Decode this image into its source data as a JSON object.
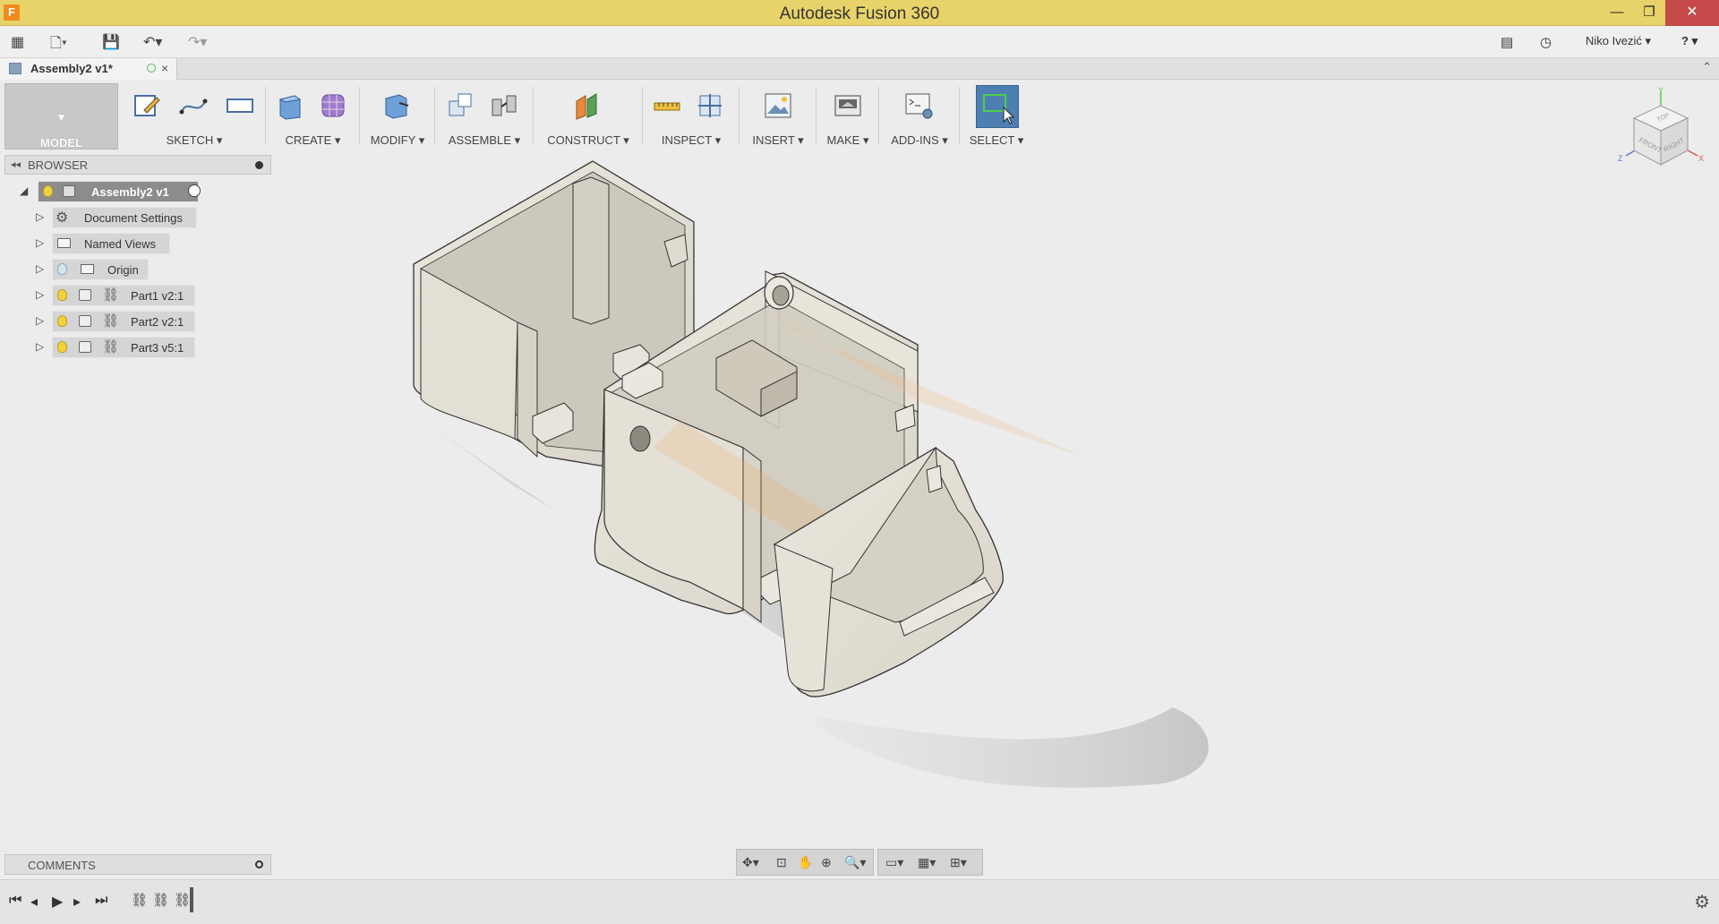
{
  "window": {
    "title": "Autodesk Fusion 360",
    "app_icon_letter": "F",
    "minimize": "—",
    "restore": "❐",
    "close": "✕"
  },
  "qat": {
    "user_name": "Niko Ivezić",
    "help": "?"
  },
  "document_tab": {
    "label": "Assembly2 v1*",
    "close": "×"
  },
  "toolbar": {
    "workspace": "MODEL",
    "groups": [
      {
        "label": "SKETCH"
      },
      {
        "label": "CREATE"
      },
      {
        "label": "MODIFY"
      },
      {
        "label": "ASSEMBLE"
      },
      {
        "label": "CONSTRUCT"
      },
      {
        "label": "INSPECT"
      },
      {
        "label": "INSERT"
      },
      {
        "label": "MAKE"
      },
      {
        "label": "ADD-INS"
      },
      {
        "label": "SELECT"
      }
    ]
  },
  "browser": {
    "header": "BROWSER",
    "root": "Assembly2 v1",
    "items": [
      {
        "label": "Document Settings"
      },
      {
        "label": "Named Views"
      },
      {
        "label": "Origin"
      },
      {
        "label": "Part1 v2:1"
      },
      {
        "label": "Part2 v2:1"
      },
      {
        "label": "Part3 v5:1"
      }
    ]
  },
  "comments": {
    "header": "COMMENTS"
  },
  "viewcube": {
    "top": "TOP",
    "front": "FRONT",
    "right": "RIGHT",
    "axis_x": "X",
    "axis_y": "Y",
    "axis_z": "Z"
  },
  "colors": {
    "title_bar": "#e8d36a",
    "close_button": "#c74a4a",
    "select_active": "#4d7fb3",
    "part_fill": "#e4e0d6"
  }
}
